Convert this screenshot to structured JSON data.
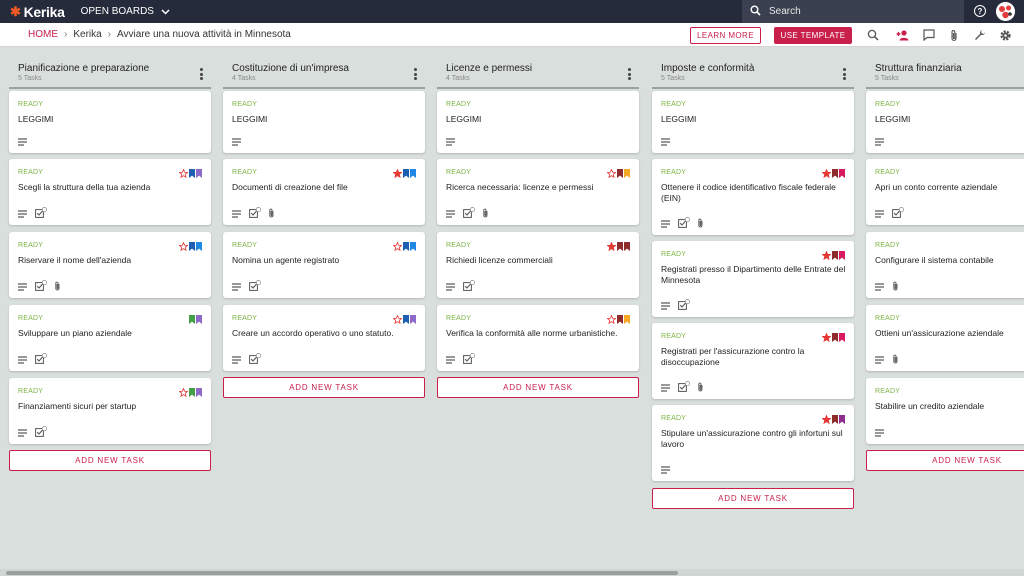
{
  "app": {
    "logo_text": "Kerika",
    "boards_label": "OPEN BOARDS"
  },
  "search": {
    "placeholder": "Search"
  },
  "breadcrumb": {
    "home": "HOME",
    "account": "Kerika",
    "board": "Avviare una nuova attività in Minnesota"
  },
  "actions": {
    "learn_more": "LEARN MORE",
    "use_template": "USE TEMPLATE"
  },
  "colors": {
    "accent": "#c81f4b",
    "status_ready": "#7cb342",
    "topbar": "#252b3a",
    "board_bg": "#d9dfdc"
  },
  "add_task_label": "ADD NEW TASK",
  "columns": [
    {
      "title": "Pianificazione e preparazione",
      "count": "5 Tasks",
      "cards": [
        {
          "status": "READY",
          "title": "LEGGIMI"
        },
        {
          "status": "READY",
          "title": "Scegli la struttura della tua azienda",
          "checklist": "2"
        },
        {
          "status": "READY",
          "title": "Riservare il nome dell'azienda",
          "checklist": "4"
        },
        {
          "status": "READY",
          "title": "Sviluppare un piano aziendale",
          "checklist": "3"
        },
        {
          "status": "READY",
          "title": "Finanziamenti sicuri per startup",
          "checklist": "3"
        }
      ]
    },
    {
      "title": "Costituzione di un'impresa",
      "count": "4 Tasks",
      "cards": [
        {
          "status": "READY",
          "title": "LEGGIMI"
        },
        {
          "status": "READY",
          "title": "Documenti di creazione del file",
          "checklist": "3"
        },
        {
          "status": "READY",
          "title": "Nomina un agente registrato",
          "checklist": "2"
        },
        {
          "status": "READY",
          "title": "Creare un accordo operativo o uno statuto.",
          "checklist": "2"
        }
      ]
    },
    {
      "title": "Licenze e permessi",
      "count": "4 Tasks",
      "cards": [
        {
          "status": "READY",
          "title": "LEGGIMI"
        },
        {
          "status": "READY",
          "title": "Ricerca necessaria: licenze e permessi",
          "checklist": "3"
        },
        {
          "status": "READY",
          "title": "Richiedi licenze commerciali",
          "checklist": "3"
        },
        {
          "status": "READY",
          "title": "Verifica la conformità alle norme urbanistiche.",
          "checklist": "3"
        }
      ]
    },
    {
      "title": "Imposte e conformità",
      "count": "5 Tasks",
      "cards": [
        {
          "status": "READY",
          "title": "LEGGIMI"
        },
        {
          "status": "READY",
          "title": "Ottenere il codice identificativo fiscale federale (EIN)",
          "checklist": "2"
        },
        {
          "status": "READY",
          "title": "Registrati presso il Dipartimento delle Entrate del Minnesota",
          "checklist": "2"
        },
        {
          "status": "READY",
          "title": "Registrati per l'assicurazione contro la disoccupazione",
          "checklist": "2"
        },
        {
          "status": "READY",
          "title": "Stipulare un'assicurazione contro gli infortuni sul lavoro"
        }
      ]
    },
    {
      "title": "Struttura finanziaria",
      "count": "5 Tasks",
      "cards": [
        {
          "status": "READY",
          "title": "LEGGIMI"
        },
        {
          "status": "READY",
          "title": "Apri un conto corrente aziendale",
          "checklist": "2"
        },
        {
          "status": "READY",
          "title": "Configurare il sistema contabile"
        },
        {
          "status": "READY",
          "title": "Ottieni un'assicurazione aziendale"
        },
        {
          "status": "READY",
          "title": "Stabilire un credito aziendale"
        }
      ]
    }
  ]
}
